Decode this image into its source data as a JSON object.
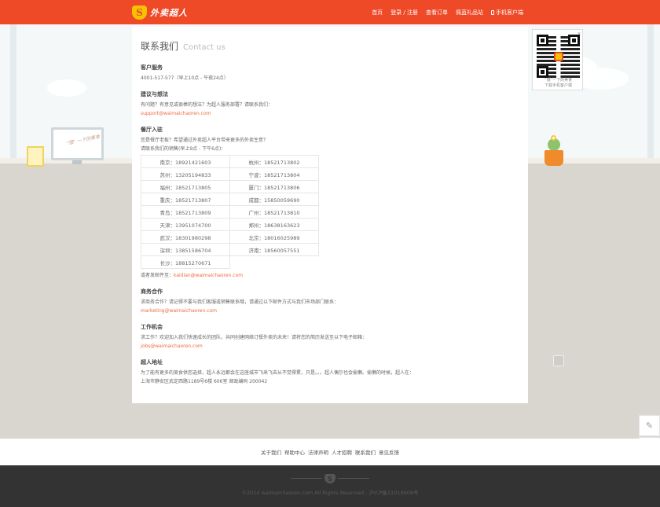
{
  "header": {
    "logo_text": "外卖超人",
    "logo_badge": "S",
    "nav": [
      "首页",
      "登录 / 注册",
      "查看订单",
      "佩蓝礼品站",
      "手机客户端"
    ]
  },
  "scene": {
    "monitor_text": "\"饿\" 一下的美食"
  },
  "contact": {
    "title_cn": "联系我们",
    "title_en": "Contact us",
    "service": {
      "heading": "客户服务",
      "phone": "4001-517-577（早上10点 - 午夜24点）"
    },
    "suggestion": {
      "heading": "建议与想法",
      "text": "有问题？有意见或很棒的想法？为超人服务部署？请联系我们：",
      "email": "support@waimaichaoren.com"
    },
    "restaurant": {
      "heading": "餐厅入驻",
      "text1": "您是餐厅老板？希望通过外卖超人平台带来更多的外卖生意？",
      "text2": "请联系我们的销售(早上9点 - 下午6点)：",
      "cities": [
        [
          "南京：18921421603",
          "杭州：18521713802"
        ],
        [
          "苏州：13205194833",
          "宁波：18521713804"
        ],
        [
          "福州：18521713805",
          "厦门：18521713806"
        ],
        [
          "重庆：18521713807",
          "成都：15850059690"
        ],
        [
          "青岛：18521713809",
          "广州：18521713810"
        ],
        [
          "天津：13951074700",
          "郑州：18638163623"
        ],
        [
          "武汉：18301980298",
          "北京：18016025989"
        ],
        [
          "深圳：13851586704",
          "济南：18560057551"
        ],
        [
          "长沙：18815270671",
          ""
        ]
      ],
      "mail_prefix": "或者发邮件至：",
      "email": "kaidian@waimaichaoren.com"
    },
    "business": {
      "heading": "商务合作",
      "text": "求商务合作？请记得不要与我们客服或销售联系哦，请通过以下邮件方式与我们市场部门联系：",
      "email": "marketing@waimaichaoren.com"
    },
    "jobs": {
      "heading": "工作机会",
      "text": "求工作？欢迎加入我们快速成长的团队，共同创建网络订餐外卖的未来！请将您的简历发送至以下电子邮箱：",
      "email": "jobs@waimaichaoren.com"
    },
    "address": {
      "heading": "超人地址",
      "text": "为了能有更多的美食供您选择，超人永远都会在这座城市飞来飞去从不觉得累，只是。。。超人偶尔也会偷懒。偷懒的时候，超人在：",
      "detail": "上海市静安区武定西路1189号6楼 606室 邮政编码 200042"
    }
  },
  "qr": {
    "close": "x",
    "caption_line1": "“饿”一下的美食",
    "caption_line2": "下载手机客户端"
  },
  "side_buttons": [
    "edit-icon",
    "qr-icon"
  ],
  "footer": {
    "links": [
      "关于我们",
      "帮助中心",
      "法律声明",
      "人才招聘",
      "联系我们",
      "意见反馈"
    ],
    "copyright": "©2014 waimaichaoren.com All Rights Reserved - 沪ICP备11019908号"
  }
}
